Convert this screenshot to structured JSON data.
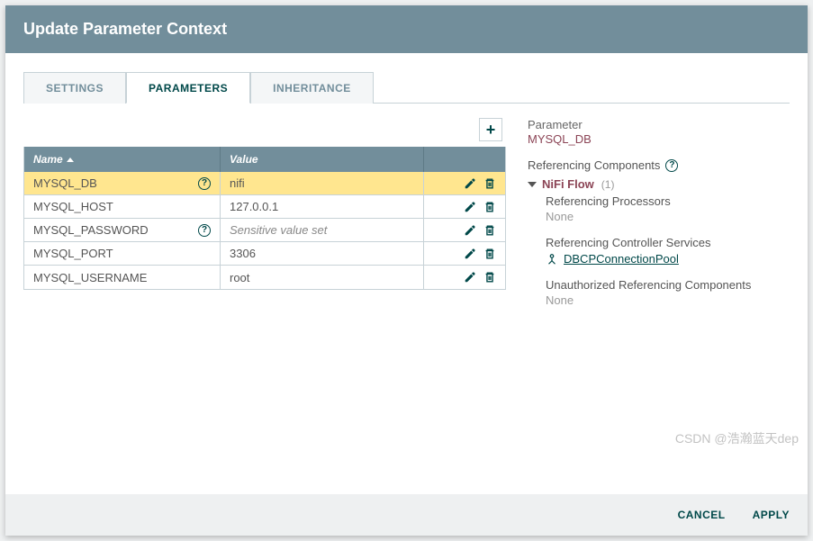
{
  "dialog": {
    "title": "Update Parameter Context"
  },
  "tabs": {
    "settings": "SETTINGS",
    "parameters": "PARAMETERS",
    "inheritance": "INHERITANCE"
  },
  "table": {
    "header": {
      "name": "Name",
      "value": "Value"
    },
    "rows": [
      {
        "name": "MYSQL_DB",
        "value": "nifi",
        "sensitive": false,
        "info": true,
        "selected": true
      },
      {
        "name": "MYSQL_HOST",
        "value": "127.0.0.1",
        "sensitive": false,
        "info": false,
        "selected": false
      },
      {
        "name": "MYSQL_PASSWORD",
        "value": "Sensitive value set",
        "sensitive": true,
        "info": true,
        "selected": false
      },
      {
        "name": "MYSQL_PORT",
        "value": "3306",
        "sensitive": false,
        "info": false,
        "selected": false
      },
      {
        "name": "MYSQL_USERNAME",
        "value": "root",
        "sensitive": false,
        "info": false,
        "selected": false
      }
    ]
  },
  "side": {
    "parameter_label": "Parameter",
    "parameter_name": "MYSQL_DB",
    "referencing_label": "Referencing Components",
    "flow_label": "NiFi Flow",
    "flow_count": "(1)",
    "processors_label": "Referencing Processors",
    "processors_none": "None",
    "services_label": "Referencing Controller Services",
    "service_link": "DBCPConnectionPool",
    "unauthorized_label": "Unauthorized Referencing Components",
    "unauthorized_none": "None"
  },
  "footer": {
    "cancel": "CANCEL",
    "apply": "APPLY"
  },
  "watermark": "CSDN @浩瀚蓝天dep"
}
